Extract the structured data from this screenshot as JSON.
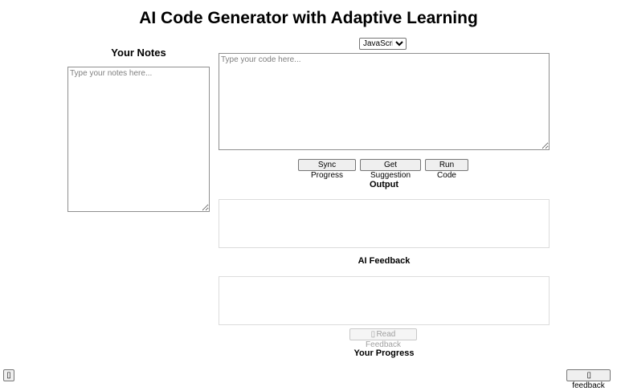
{
  "page": {
    "title": "AI Code Generator with Adaptive Learning"
  },
  "notes": {
    "heading": "Your Notes",
    "placeholder": "Type your notes here...",
    "value": ""
  },
  "editor": {
    "language_selected": "JavaScript",
    "language_options": [
      "JavaScript"
    ],
    "placeholder": "Type your code here...",
    "value": ""
  },
  "actions": {
    "sync_label": "Sync Progress",
    "suggest_label": "Get Suggestion",
    "run_label": "Run Code"
  },
  "output": {
    "heading": "Output",
    "content": ""
  },
  "feedback": {
    "heading": "AI Feedback",
    "content": "",
    "read_label": "Read Feedback",
    "read_icon": "speaker-icon"
  },
  "progress": {
    "heading": "Your Progress"
  },
  "corner": {
    "left_icon": "menu-icon",
    "feedback_label": "feedback",
    "feedback_icon": "feedback-icon"
  }
}
